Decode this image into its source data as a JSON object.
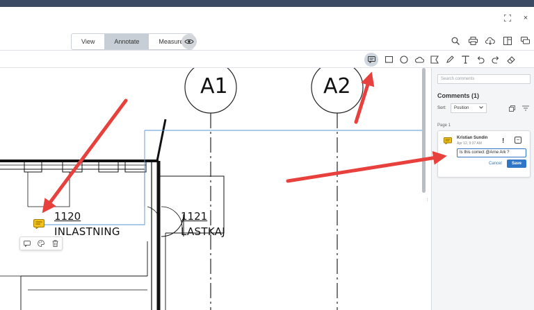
{
  "window": {
    "expand_icon": "expand-icon",
    "close_label": "×"
  },
  "modes": {
    "view": "View",
    "annotate": "Annotate",
    "measure": "Measure"
  },
  "header_tools": [
    "search-icon",
    "print-icon",
    "download-icon",
    "panel-toggle-icon",
    "comments-toggle-icon"
  ],
  "annotation_tools": [
    "comment-note-icon",
    "rectangle-icon",
    "ellipse-icon",
    "cloud-icon",
    "polygon-icon",
    "pen-icon",
    "text-icon",
    "undo-icon",
    "redo-icon",
    "eraser-icon"
  ],
  "drawing": {
    "grid_a1": "A1",
    "grid_a2": "A2",
    "room1_number": "1120",
    "room1_name": "INLASTNING",
    "room2_number": "1121",
    "room2_name": "LASTKAJ"
  },
  "panel": {
    "search_placeholder": "Search comments",
    "title": "Comments (1)",
    "sort_label": "Sort:",
    "sort_value": "Position",
    "page_label": "Page 1"
  },
  "comment": {
    "author": "Kristian Sundin",
    "date": "Apr 12, 9:37 AM",
    "priority": "!",
    "reply_value": "Is this correct @Arne Ark ?",
    "cancel": "Cancel",
    "save": "Save"
  },
  "colors": {
    "accent": "#2f76c8",
    "arrow": "#e8403c",
    "topbar": "#3b4b63",
    "note": "#f2c21b"
  }
}
